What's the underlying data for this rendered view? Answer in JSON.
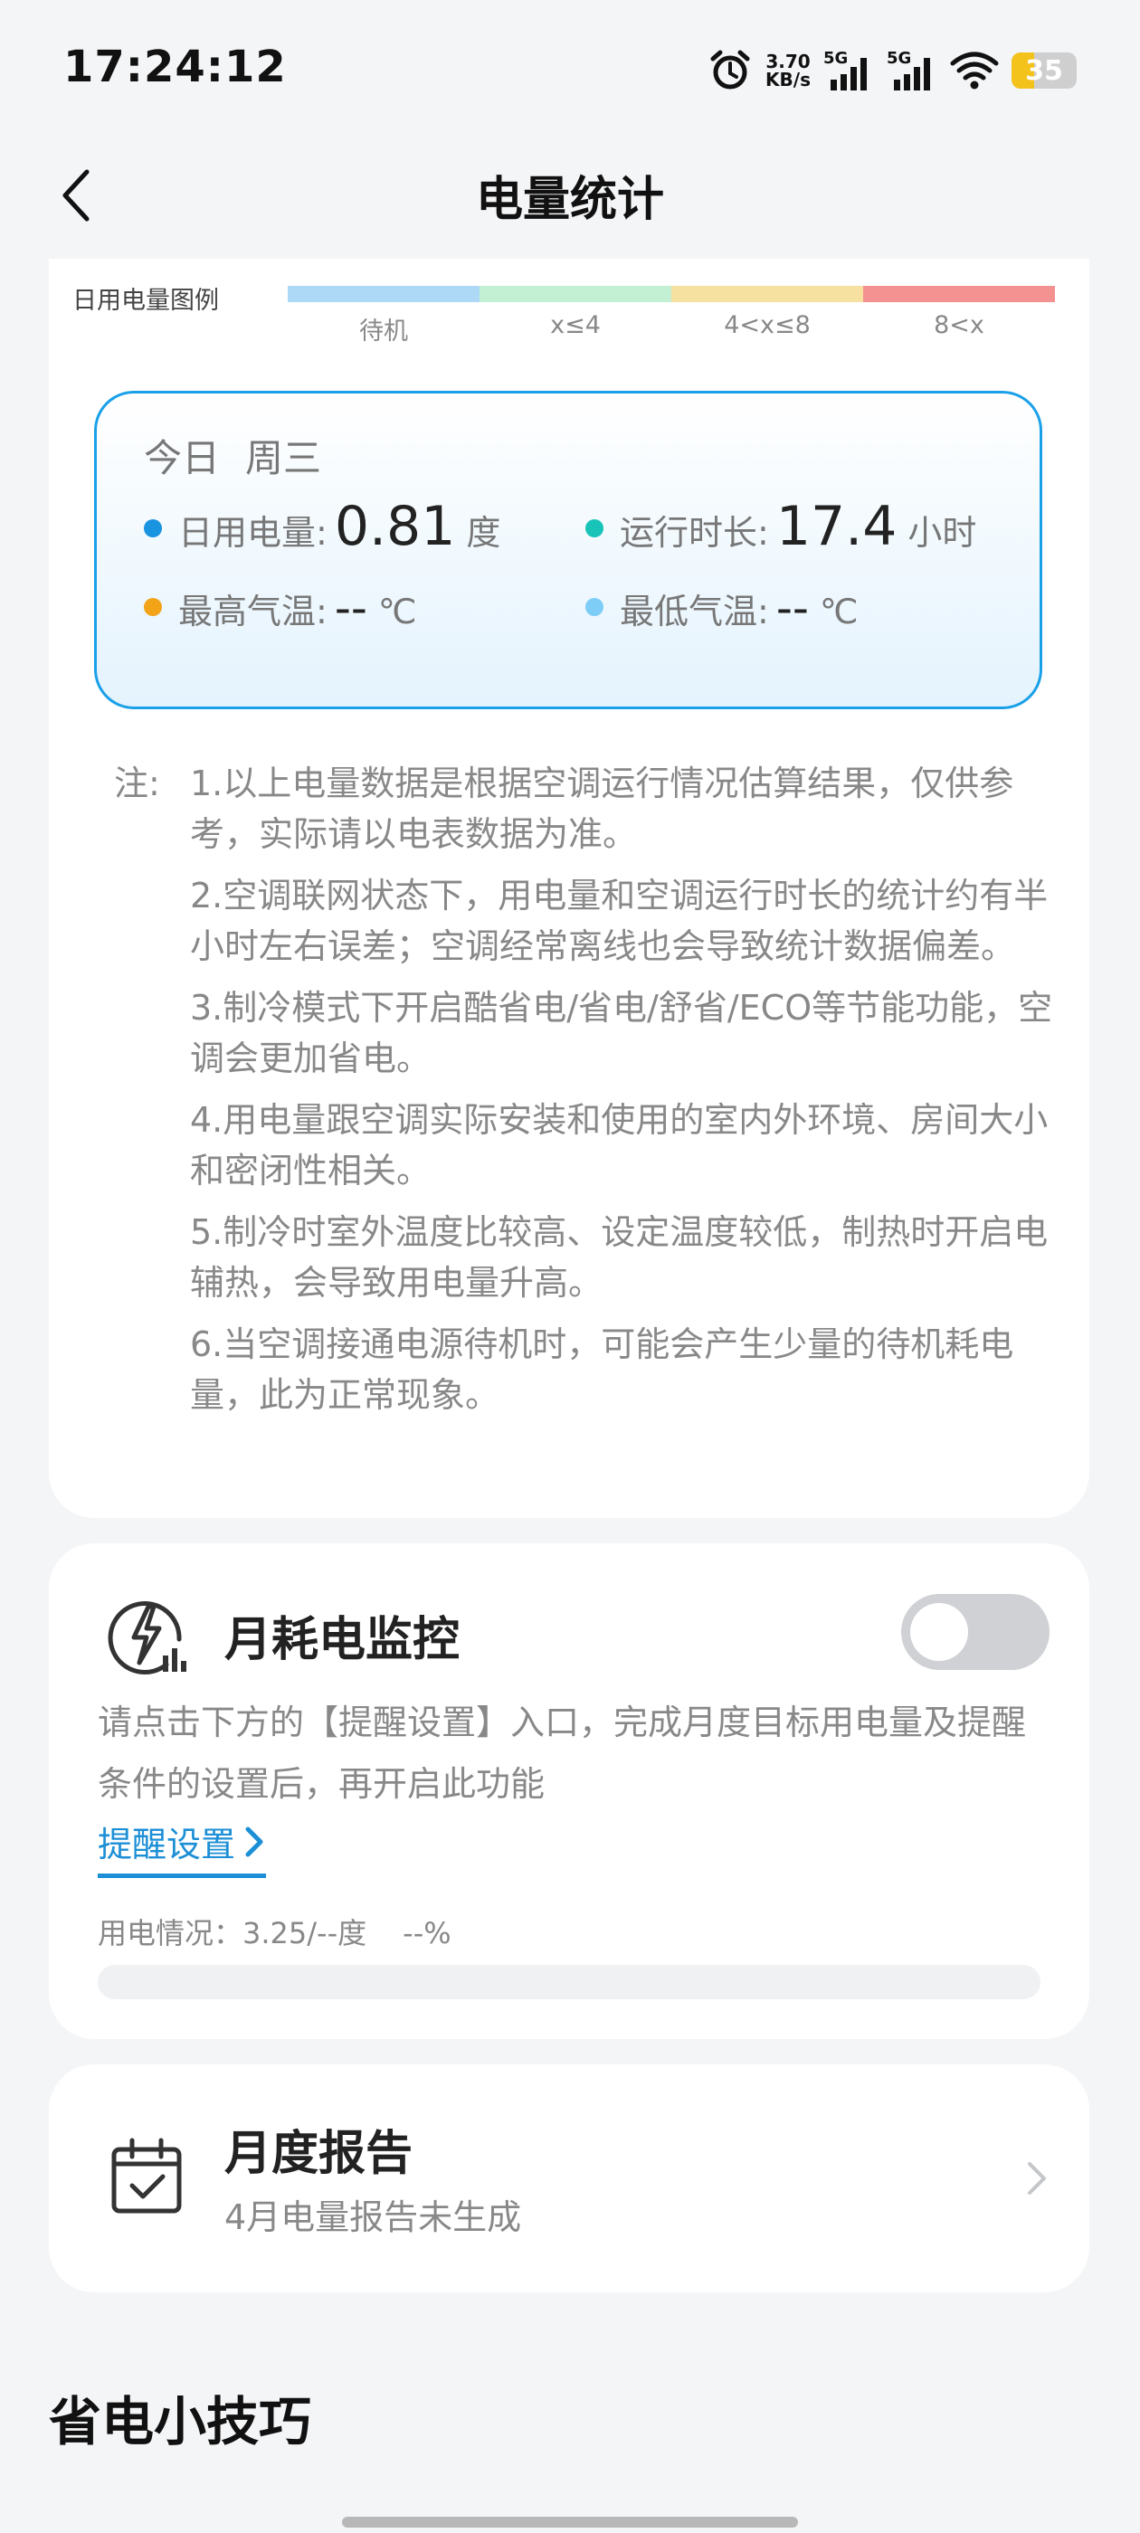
{
  "status_bar": {
    "time": "17:24:12",
    "net_speed_value": "3.70",
    "net_speed_unit": "KB/s",
    "signal1_label": "5G",
    "signal2_label": "5G",
    "battery_level": "35",
    "battery_fraction": 0.35,
    "battery_color": "#f3c21b"
  },
  "header": {
    "title": "电量统计"
  },
  "legend": {
    "title": "日用电量图例",
    "items": [
      {
        "label": "待机",
        "color": "#aed9f6"
      },
      {
        "label": "x≤4",
        "color": "#c3f0d2"
      },
      {
        "label": "4<x≤8",
        "color": "#f7e1a1"
      },
      {
        "label": "8<x",
        "color": "#f49191"
      }
    ]
  },
  "today": {
    "day": "今日",
    "weekday": "周三",
    "daily_energy": {
      "label": "日用电量:",
      "value": "0.81",
      "unit": "度",
      "dot_color": "#1a93e0"
    },
    "runtime": {
      "label": "运行时长:",
      "value": "17.4",
      "unit": "小时",
      "dot_color": "#18c4b8"
    },
    "max_temp": {
      "label": "最高气温:",
      "value": "--",
      "unit": "℃",
      "dot_color": "#f2a318"
    },
    "min_temp": {
      "label": "最低气温:",
      "value": "--",
      "unit": "℃",
      "dot_color": "#7dcdf6"
    }
  },
  "notes": {
    "prefix": "注:",
    "items": [
      "1.以上电量数据是根据空调运行情况估算结果，仅供参考，实际请以电表数据为准。",
      "2.空调联网状态下，用电量和空调运行时长的统计约有半小时左右误差；空调经常离线也会导致统计数据偏差。",
      "3.制冷模式下开启酷省电/省电/舒省/ECO等节能功能，空调会更加省电。",
      "4.用电量跟空调实际安装和使用的室内外环境、房间大小和密闭性相关。",
      "5.制冷时室外温度比较高、设定温度较低，制热时开启电辅热，会导致用电量升高。",
      "6.当空调接通电源待机时，可能会产生少量的待机耗电量，此为正常现象。"
    ]
  },
  "monitor": {
    "title": "月耗电监控",
    "toggle_on": false,
    "description": "请点击下方的【提醒设置】入口，完成月度目标用电量及提醒条件的设置后，再开启此功能",
    "link_label": "提醒设置",
    "usage_text": "用电情况：3.25/--度",
    "usage_percent": "--%",
    "progress_fraction": 0
  },
  "report": {
    "title": "月度报告",
    "subtitle": "4月电量报告未生成"
  },
  "tips": {
    "title": "省电小技巧"
  },
  "colors": {
    "accent": "#1c8fd6",
    "box_border": "#1aa0e8"
  }
}
